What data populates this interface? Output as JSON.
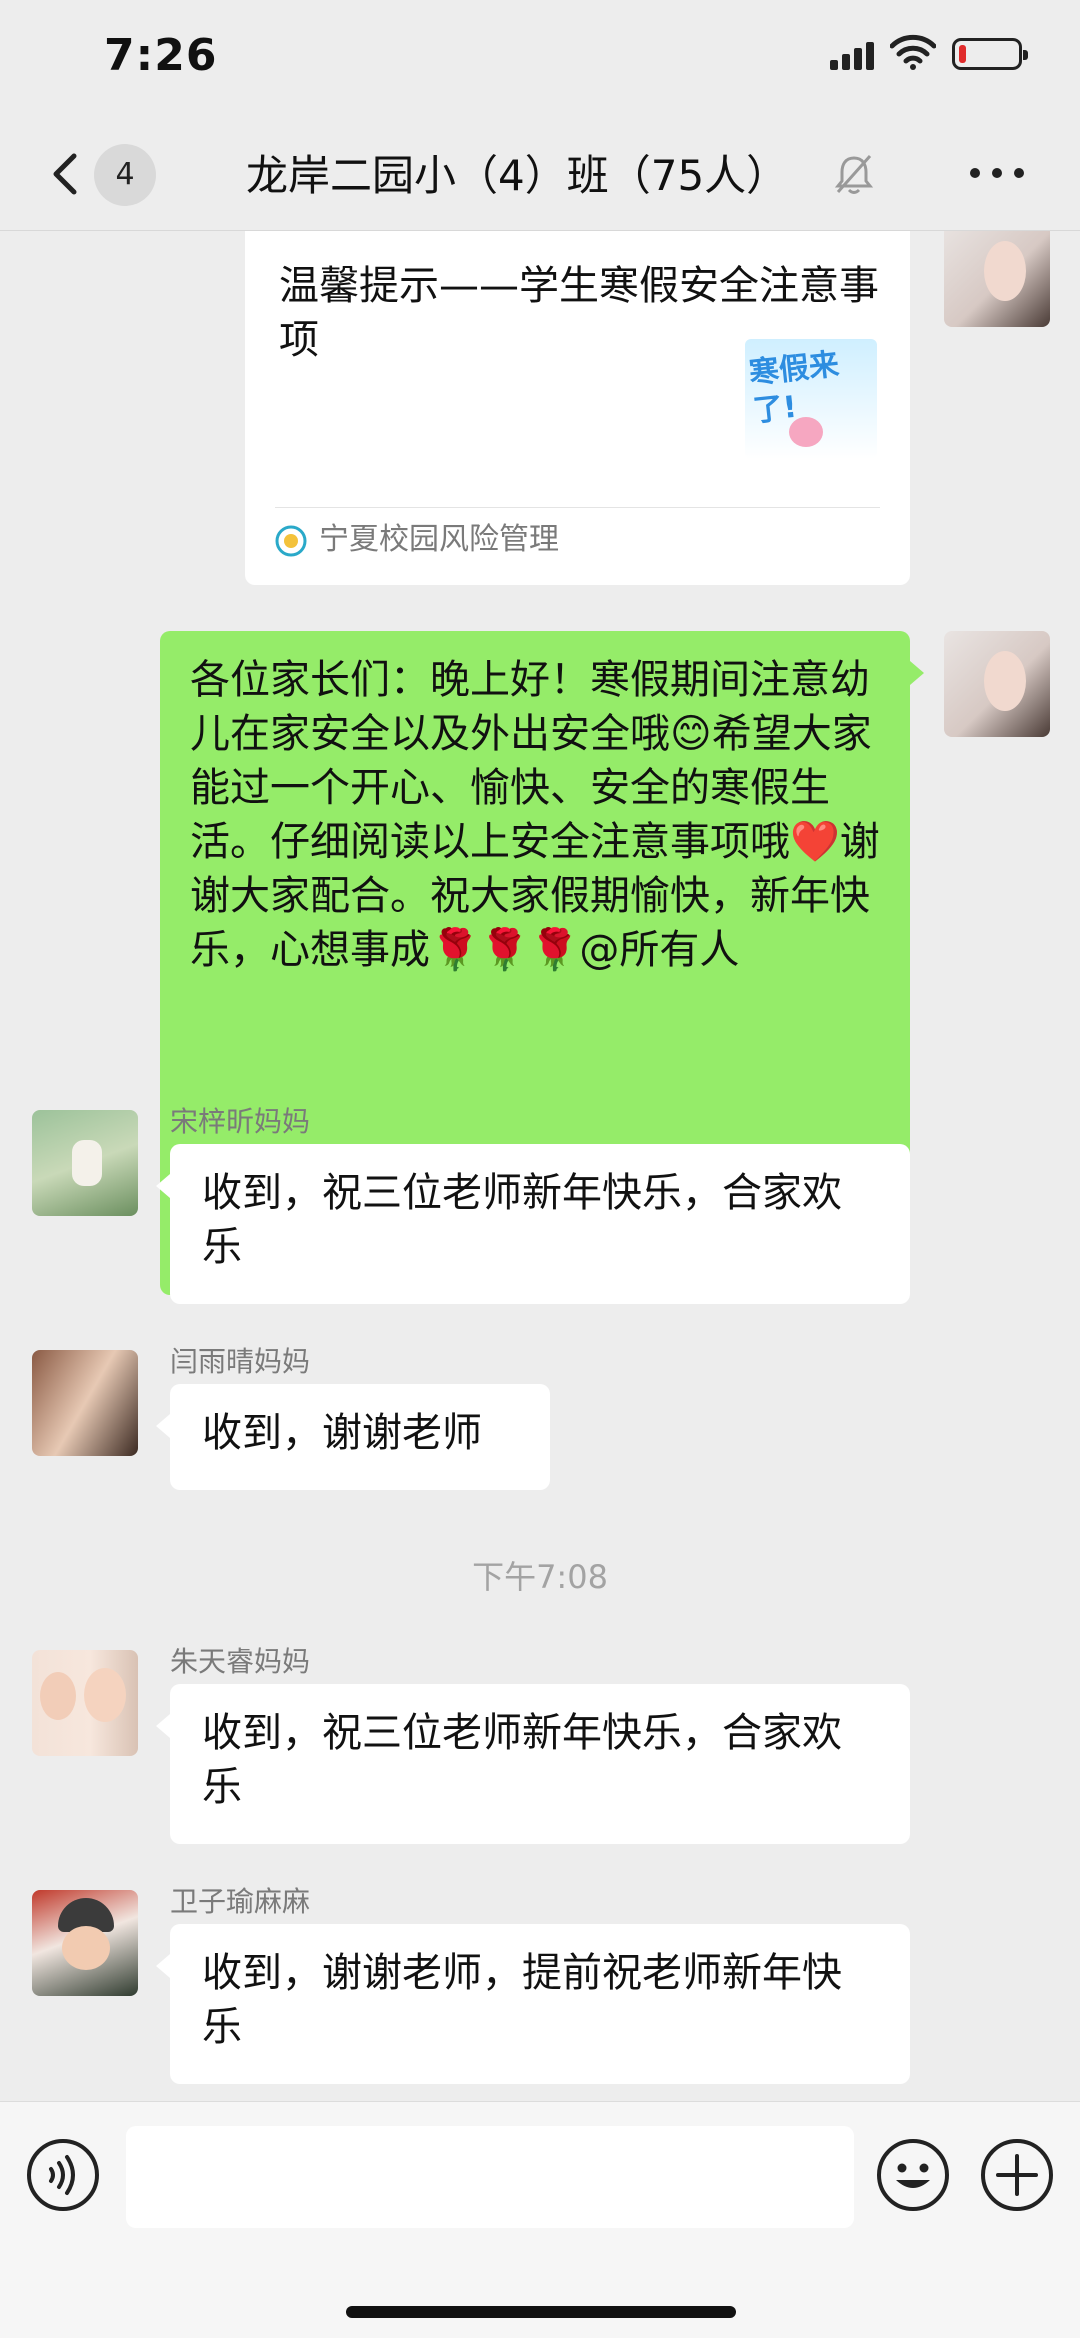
{
  "status_bar": {
    "time": "7:26"
  },
  "nav": {
    "unread_count": "4",
    "title": "龙岸二园小（4）班（75人）"
  },
  "messages": {
    "card": {
      "title": "温馨提示——学生寒假安全注意事项",
      "thumb_text": "寒假来了!",
      "source": "宁夏校园风险管理"
    },
    "teacher_msg": "各位家长们：晚上好！寒假期间注意幼儿在家安全以及外出安全哦😊希望大家能过一个开心、愉快、安全的寒假生活。仔细阅读以上安全注意事项哦❤️谢谢大家配合。祝大家假期愉快，新年快乐，心想事成🌹🌹🌹@所有人",
    "m1": {
      "sender": "宋梓昕妈妈",
      "text": "收到，祝三位老师新年快乐，合家欢乐"
    },
    "m2": {
      "sender": "闫雨晴妈妈",
      "text": "收到，谢谢老师"
    },
    "timestamp": "下午7:08",
    "m3": {
      "sender": "朱天睿妈妈",
      "text": "收到，祝三位老师新年快乐，合家欢乐"
    },
    "m4": {
      "sender": "卫子瑜麻麻",
      "text": "收到，谢谢老师，提前祝老师新年快乐"
    }
  },
  "input_bar": {
    "placeholder": ""
  },
  "colors": {
    "chat_bg": "#ededed",
    "self_bubble": "#95ec69",
    "other_bubble": "#ffffff",
    "battery_low": "#e02b2b"
  }
}
